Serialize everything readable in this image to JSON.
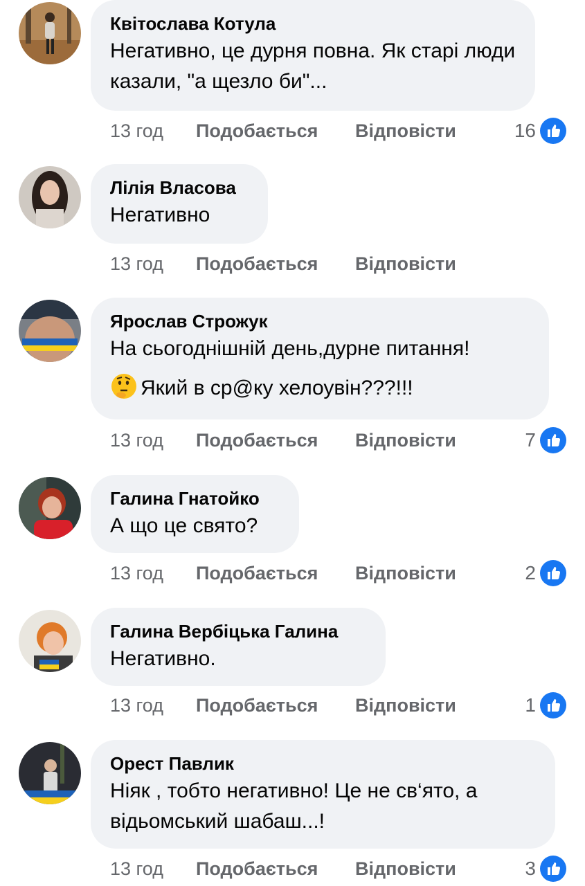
{
  "colors": {
    "bubble": "#f0f2f5",
    "meta_text": "#65676b",
    "like_blue": "#1877f2"
  },
  "actions": {
    "like": "Подобається",
    "reply": "Відповісти"
  },
  "comments": [
    {
      "author": "Квітослава Котула",
      "text": "Негативно, це дурня повна. Як старі люди казали, \"а щезло би\"...",
      "time": "13 год",
      "reactions": "16"
    },
    {
      "author": "Лілія Власова",
      "text": "Негативно",
      "time": "13 год",
      "reactions": ""
    },
    {
      "author": "Ярослав Строжук",
      "text": "На сьогоднішній день,дурне питання!",
      "text2": "Який в ср@ку хелоувін???!!!",
      "emoji": "thinking-face",
      "time": "13 год",
      "reactions": "7"
    },
    {
      "author": "Галина Гнатойко",
      "text": "А що це свято?",
      "time": "13 год",
      "reactions": "2"
    },
    {
      "author": "Галина Вербіцька Галина",
      "text": "Негативно.",
      "time": "13 год",
      "reactions": "1"
    },
    {
      "author": "Орест Павлик",
      "text": "Ніяк , тобто негативно! Це не св‘ято, а відьомський шабаш...!",
      "time": "13 год",
      "reactions": "3"
    }
  ]
}
